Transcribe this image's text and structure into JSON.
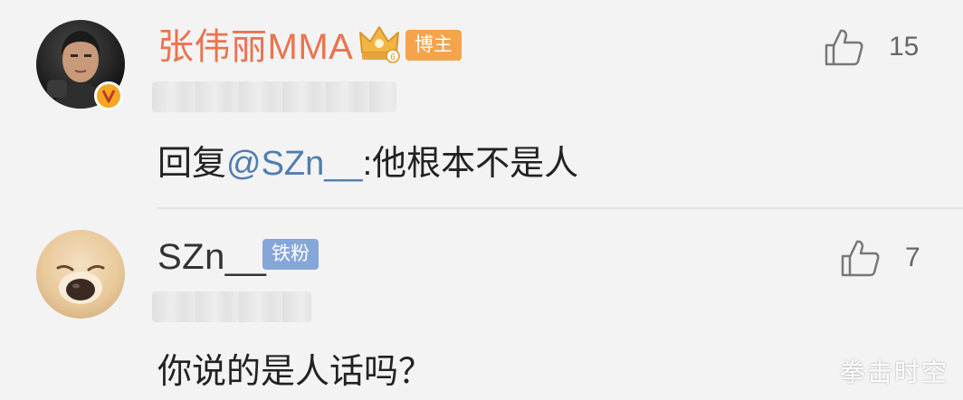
{
  "colors": {
    "background": "#f3f3f3",
    "username_highlight": "#eb7350",
    "mention_link": "#507daf",
    "tag_blogger": "#f5a44b",
    "tag_fan": "#85a6d9",
    "verified_badge": "#f5a623"
  },
  "comments": [
    {
      "username": "张伟丽MMA",
      "verified": true,
      "level_icon": "crown-icon",
      "tag": "博主",
      "reply_prefix": "回复",
      "mention": "@SZn__",
      "text": ":他根本不是人",
      "likes": "15"
    },
    {
      "username": "SZn__",
      "verified": false,
      "tag": "铁粉",
      "text": "你说的是人话吗？",
      "likes": "7"
    }
  ],
  "watermark": "拳击时空"
}
